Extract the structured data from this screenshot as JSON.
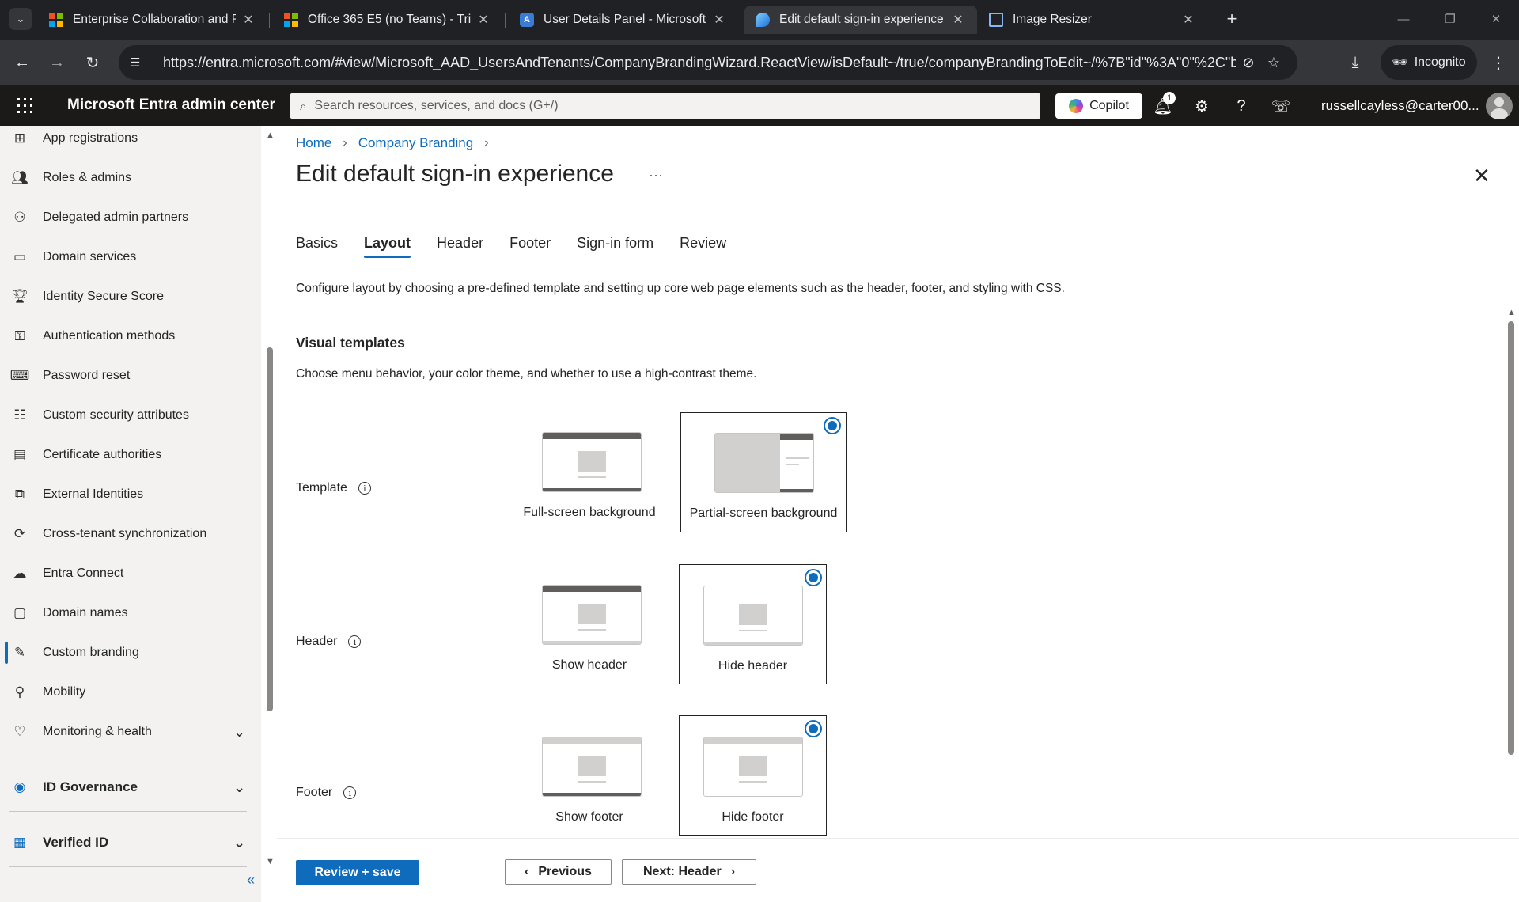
{
  "browser": {
    "tabs": [
      {
        "title": "Enterprise Collaboration and Pr",
        "favicon": "microsoft-logo-icon"
      },
      {
        "title": "Office 365 E5 (no Teams) - Trial",
        "favicon": "microsoft-logo-icon"
      },
      {
        "title": "User Details Panel - Microsoft 3",
        "favicon": "admin-center-icon"
      },
      {
        "title": "Edit default sign-in experience -",
        "favicon": "entra-icon"
      },
      {
        "title": "Image Resizer",
        "favicon": "image-resizer-icon"
      }
    ],
    "active_tab_index": 3,
    "url": "https://entra.microsoft.com/#view/Microsoft_AAD_UsersAndTenants/CompanyBrandingWizard.ReactView/isDefault~/true/companyBrandingToEdit~/%7B\"id\"%3A\"0\"%2C\"backgro...",
    "incognito_label": "Incognito"
  },
  "appbar": {
    "brand": "Microsoft Entra admin center",
    "search_placeholder": "Search resources, services, and docs (G+/)",
    "copilot_label": "Copilot",
    "notification_count": "1",
    "user": "russellcayless@carter00..."
  },
  "sidebar": {
    "items": [
      {
        "label": "App registrations",
        "icon": "app-registrations-icon"
      },
      {
        "label": "Roles & admins",
        "icon": "roles-icon"
      },
      {
        "label": "Delegated admin partners",
        "icon": "partners-icon"
      },
      {
        "label": "Domain services",
        "icon": "domain-services-icon"
      },
      {
        "label": "Identity Secure Score",
        "icon": "trophy-icon"
      },
      {
        "label": "Authentication methods",
        "icon": "key-icon"
      },
      {
        "label": "Password reset",
        "icon": "password-icon"
      },
      {
        "label": "Custom security attributes",
        "icon": "attributes-icon"
      },
      {
        "label": "Certificate authorities",
        "icon": "certificate-icon"
      },
      {
        "label": "External Identities",
        "icon": "external-identities-icon"
      },
      {
        "label": "Cross-tenant synchronization",
        "icon": "sync-icon"
      },
      {
        "label": "Entra Connect",
        "icon": "cloud-connect-icon"
      },
      {
        "label": "Domain names",
        "icon": "domain-names-icon"
      },
      {
        "label": "Custom branding",
        "icon": "branding-icon"
      },
      {
        "label": "Mobility",
        "icon": "mobility-icon"
      },
      {
        "label": "Monitoring & health",
        "icon": "heart-monitor-icon"
      }
    ],
    "active_item": "Custom branding",
    "sections": [
      {
        "label": "ID Governance",
        "icon": "id-governance-icon"
      },
      {
        "label": "Verified ID",
        "icon": "verified-id-icon"
      }
    ]
  },
  "main": {
    "breadcrumb": [
      "Home",
      "Company Branding"
    ],
    "title": "Edit default sign-in experience",
    "tabs": [
      "Basics",
      "Layout",
      "Header",
      "Footer",
      "Sign-in form",
      "Review"
    ],
    "active_tab": "Layout",
    "description": "Configure layout by choosing a pre-defined template and setting up core web page elements such as the header, footer, and styling with CSS.",
    "visual_templates": {
      "title": "Visual templates",
      "description": "Choose menu behavior, your color theme, and whether to use a high-contrast theme."
    },
    "template": {
      "label": "Template",
      "options": [
        "Full-screen background",
        "Partial-screen background"
      ],
      "selected": "Partial-screen background"
    },
    "header": {
      "label": "Header",
      "options": [
        "Show header",
        "Hide header"
      ],
      "selected": "Hide header"
    },
    "footer": {
      "label": "Footer",
      "options": [
        "Show footer",
        "Hide footer"
      ],
      "selected": "Hide footer"
    },
    "buttons": {
      "review_save": "Review + save",
      "previous": "Previous",
      "next": "Next: Header"
    }
  },
  "colors": {
    "accent": "#0f6cbd",
    "appbar": "#1b1a19",
    "sidebar": "#f3f2f1"
  }
}
